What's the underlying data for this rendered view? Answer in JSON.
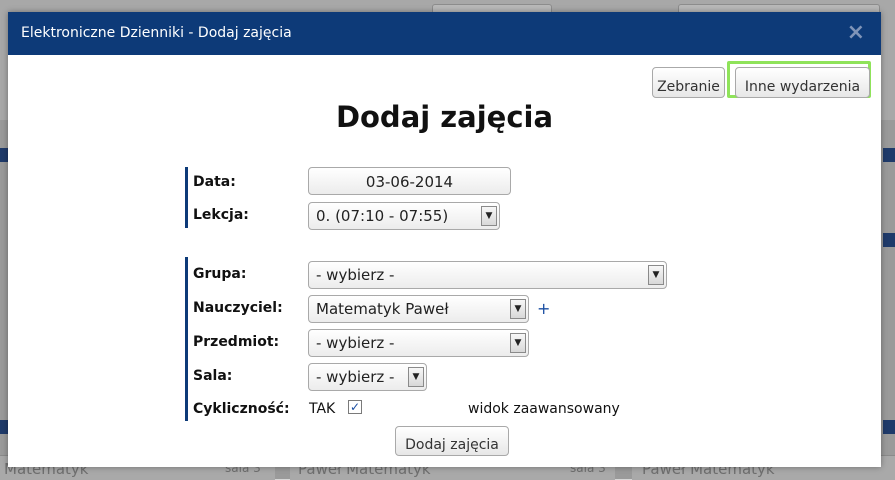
{
  "modal": {
    "window_title": "Elektroniczne Dzienniki - Dodaj zajęcia",
    "close_icon": "×",
    "heading": "Dodaj zajęcia",
    "buttons": {
      "meeting": "Zebranie",
      "other_events": "Inne wydarzenia",
      "submit": "Dodaj zajęcia"
    }
  },
  "form": {
    "labels": {
      "date": "Data:",
      "lesson": "Lekcja:",
      "group": "Grupa:",
      "teacher": "Nauczyciel:",
      "subject": "Przedmiot:",
      "room": "Sala:",
      "cyclic": "Cykliczność:"
    },
    "values": {
      "date": "03-06-2014",
      "lesson": "0. (07:10 - 07:55)",
      "group": "- wybierz -",
      "teacher": "Matematyk Paweł",
      "subject": "- wybierz -",
      "room": "- wybierz -"
    },
    "add_teacher": "+",
    "cyclic_text": "TAK",
    "cyclic_checked": true,
    "advanced_view": "widok zaawansowany"
  },
  "background": {
    "cells": [
      "Matematyk",
      "sala 3",
      "Paweł Matematyk",
      "sala 3",
      "Paweł Matematyk"
    ]
  },
  "colors": {
    "header": "#0d3a78",
    "highlight": "#8fe35a",
    "accent": "#1a4ea2"
  }
}
